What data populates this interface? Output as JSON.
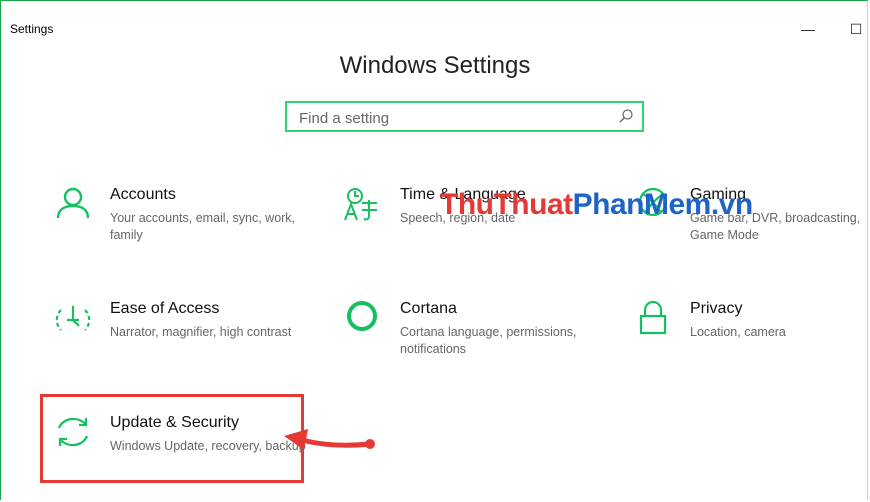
{
  "window": {
    "title": "Settings",
    "minimize_glyph": "—",
    "maximize_glyph": "☐"
  },
  "header": {
    "title": "Windows Settings"
  },
  "search": {
    "placeholder": "Find a setting",
    "icon": "search-icon"
  },
  "tiles": [
    {
      "name": "Accounts",
      "desc": "Your accounts, email, sync, work, family",
      "icon": "person-icon"
    },
    {
      "name": "Time & Language",
      "desc": "Speech, region, date",
      "icon": "language-icon"
    },
    {
      "name": "Gaming",
      "desc": "Game bar, DVR, broadcasting, Game Mode",
      "icon": "xbox-icon"
    },
    {
      "name": "Ease of Access",
      "desc": "Narrator, magnifier, high contrast",
      "icon": "ease-of-access-icon"
    },
    {
      "name": "Cortana",
      "desc": "Cortana language, permissions, notifications",
      "icon": "cortana-icon"
    },
    {
      "name": "Privacy",
      "desc": "Location, camera",
      "icon": "lock-icon"
    },
    {
      "name": "Update & Security",
      "desc": "Windows Update, recovery, backup",
      "icon": "sync-icon"
    }
  ],
  "watermark": {
    "part1": "ThuThuat",
    "part2": "PhanMem",
    "part3": ".vn"
  },
  "colors": {
    "accent": "#16c060",
    "highlight": "#e53935",
    "watermark_red": "#e53935",
    "watermark_blue": "#1e63c8"
  }
}
